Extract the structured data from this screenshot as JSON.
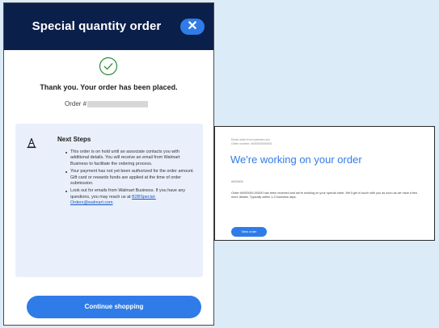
{
  "modal": {
    "title": "Special quantity order",
    "close_symbol": "✕",
    "icons": {
      "success": "check-circle-icon",
      "close": "close-icon",
      "next_steps": "traffic-cone-icon"
    },
    "thank_you": "Thank you. Your order has been placed.",
    "order_label": "Order #",
    "next_steps": {
      "title": "Next Steps",
      "items": [
        "This order is on hold until an associate contacts you with additional details. You will receive an email from Walmart Business to facilitate the ordering process.",
        "Your payment has not yet been authorized for the order amount. Gift card or rewards funds are applied at the time of order submission."
      ],
      "last_item_text": "Look out for emails from Walmart Business. If you have any questions, you may reach us at",
      "email_link": "B2BSpecial-Orders@walmart.com",
      "email_suffix": "."
    },
    "continue_label": "Continue shopping"
  },
  "email_card": {
    "meta_line1": "Email order from walmart.com",
    "meta_line2": "Order number: #000000000000",
    "title": "We're working on your order",
    "tag": "#000000",
    "body": "Order #0000000-00000 has been received and we're working on your special order. We'll get in touch with you as soon as we have a few more details. Typically within 1-2 business days.",
    "button_label": "View order"
  },
  "colors": {
    "page_background": "#dcebf8",
    "header": "#0b1f4b",
    "accent": "#2f7ce8",
    "next_steps_box": "#e9f0fb",
    "success": "#2e8a3a"
  }
}
